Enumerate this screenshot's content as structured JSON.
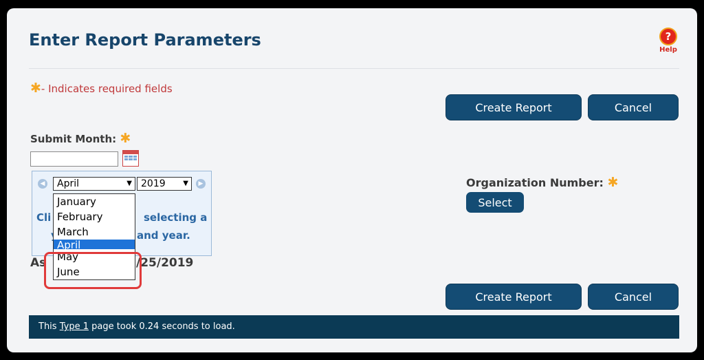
{
  "header": {
    "title": "Enter Report Parameters",
    "help_label": "Help",
    "help_glyph": "?"
  },
  "required_note": {
    "star": "✱",
    "text": "- Indicates required fields"
  },
  "buttons": {
    "create_report": "Create Report",
    "cancel": "Cancel",
    "select": "Select"
  },
  "submit_month": {
    "label": "Submit Month:",
    "star": "✱",
    "input_value": "",
    "picker": {
      "month_selected": "April",
      "year_selected": "2019",
      "hint_visible": "Cli",
      "hint_line1_right": "selecting a",
      "hint_line2_left": "y",
      "hint_line2_right": "and year.",
      "month_options": [
        "January",
        "February",
        "March",
        "April",
        "May",
        "June"
      ],
      "active_option_index": 3
    }
  },
  "as_of": {
    "prefix": "As",
    "date_tail": "/25/2019"
  },
  "organization": {
    "label": "Organization Number:",
    "star": "✱"
  },
  "footer": {
    "before": "This ",
    "link": "Type 1",
    "after": " page took 0.24 seconds to load."
  },
  "colors": {
    "accent": "#144c74",
    "required_star": "#f5a623",
    "required_text": "#c0393b",
    "highlight": "#e03a3a"
  }
}
